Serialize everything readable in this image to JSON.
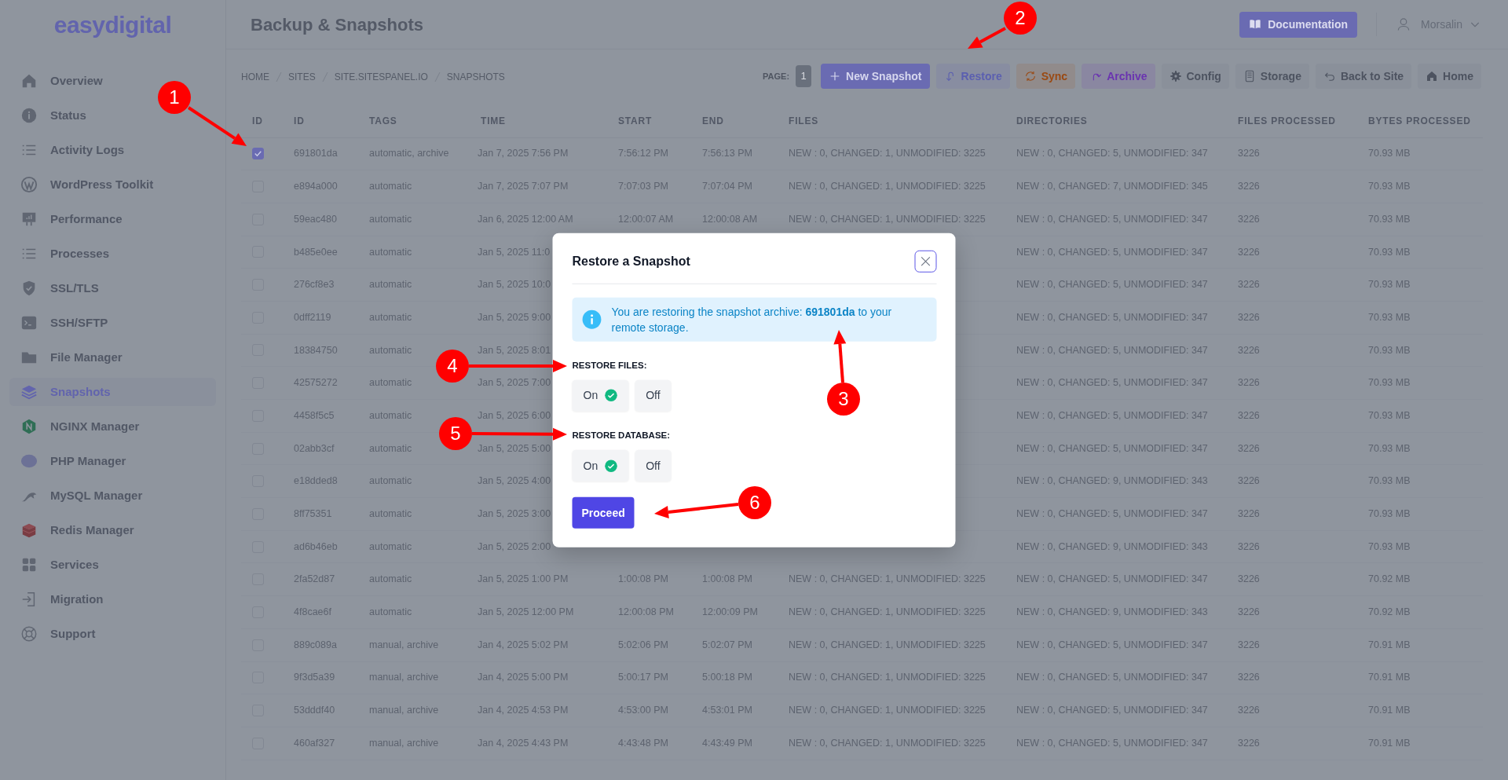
{
  "sidebar": {
    "logo": "easydigital",
    "items": [
      {
        "label": "Overview",
        "selected": false
      },
      {
        "label": "Status",
        "selected": false
      },
      {
        "label": "Activity Logs",
        "selected": false
      },
      {
        "label": "WordPress Toolkit",
        "selected": false
      },
      {
        "label": "Performance",
        "selected": false
      },
      {
        "label": "Processes",
        "selected": false
      },
      {
        "label": "SSL/TLS",
        "selected": false
      },
      {
        "label": "SSH/SFTP",
        "selected": false
      },
      {
        "label": "File Manager",
        "selected": false
      },
      {
        "label": "Snapshots",
        "selected": true
      },
      {
        "label": "NGINX Manager",
        "selected": false
      },
      {
        "label": "PHP Manager",
        "selected": false
      },
      {
        "label": "MySQL Manager",
        "selected": false
      },
      {
        "label": "Redis Manager",
        "selected": false
      },
      {
        "label": "Services",
        "selected": false
      },
      {
        "label": "Migration",
        "selected": false
      },
      {
        "label": "Support",
        "selected": false
      }
    ]
  },
  "header": {
    "title": "Backup & Snapshots",
    "documentation": "Documentation",
    "user": "Morsalin"
  },
  "breadcrumb": [
    "HOME",
    "SITES",
    "SITE.SITESPANEL.IO",
    "SNAPSHOTS"
  ],
  "toolbar": {
    "page_label": "PAGE:",
    "page": "1",
    "buttons": [
      {
        "label": "New Snapshot",
        "kind": "filled",
        "color": "#6a6bb2"
      },
      {
        "label": "Restore",
        "kind": "soft",
        "color": "#5b5fb0"
      },
      {
        "label": "Sync",
        "kind": "soft",
        "color": "#9a4a14"
      },
      {
        "label": "Archive",
        "kind": "soft",
        "color": "#6a34b0"
      },
      {
        "label": "Config",
        "kind": "plain",
        "color": "#4d5360"
      },
      {
        "label": "Storage",
        "kind": "plain",
        "color": "#4d5360"
      },
      {
        "label": "Back to Site",
        "kind": "plain",
        "color": "#4d5360"
      },
      {
        "label": "Home",
        "kind": "plain",
        "color": "#4d5360"
      }
    ]
  },
  "table": {
    "columns": [
      "ID",
      "ID",
      "TAGS",
      "TIME",
      "START",
      "END",
      "FILES",
      "DIRECTORIES",
      "FILES PROCESSED",
      "BYTES PROCESSED"
    ],
    "rows": [
      {
        "checked": true,
        "cells": [
          "",
          "691801da",
          "automatic, archive",
          "Jan 7, 2025 7:56 PM",
          "7:56:12 PM",
          "7:56:13 PM",
          "NEW : 0, CHANGED: 1, UNMODIFIED: 3225",
          "NEW : 0, CHANGED: 5, UNMODIFIED: 347",
          "3226",
          "70.93 MB"
        ]
      },
      {
        "checked": false,
        "cells": [
          "",
          "e894a000",
          "automatic",
          "Jan 7, 2025 7:07 PM",
          "7:07:03 PM",
          "7:07:04 PM",
          "NEW : 0, CHANGED: 1, UNMODIFIED: 3225",
          "NEW : 0, CHANGED: 7, UNMODIFIED: 345",
          "3226",
          "70.93 MB"
        ]
      },
      {
        "checked": false,
        "cells": [
          "",
          "59eac480",
          "automatic",
          "Jan 6, 2025 12:00 AM",
          "12:00:07 AM",
          "12:00:08 AM",
          "NEW : 0, CHANGED: 1, UNMODIFIED: 3225",
          "NEW : 0, CHANGED: 5, UNMODIFIED: 347",
          "3226",
          "70.93 MB"
        ]
      },
      {
        "checked": false,
        "cells": [
          "",
          "b485e0ee",
          "automatic",
          "Jan 5, 2025 11:0",
          null,
          null,
          null,
          "NEW : 0, CHANGED: 5, UNMODIFIED: 347",
          "3226",
          "70.93 MB"
        ]
      },
      {
        "checked": false,
        "cells": [
          "",
          "276cf8e3",
          "automatic",
          "Jan 5, 2025 10:0",
          null,
          null,
          null,
          "NEW : 0, CHANGED: 5, UNMODIFIED: 347",
          "3226",
          "70.93 MB"
        ]
      },
      {
        "checked": false,
        "cells": [
          "",
          "0dff2119",
          "automatic",
          "Jan 5, 2025 9:00",
          null,
          null,
          null,
          "NEW : 0, CHANGED: 5, UNMODIFIED: 347",
          "3226",
          "70.93 MB"
        ]
      },
      {
        "checked": false,
        "cells": [
          "",
          "18384750",
          "automatic",
          "Jan 5, 2025 8:01",
          null,
          null,
          null,
          "NEW : 0, CHANGED: 5, UNMODIFIED: 347",
          "3226",
          "70.93 MB"
        ]
      },
      {
        "checked": false,
        "cells": [
          "",
          "42575272",
          "automatic",
          "Jan 5, 2025 7:00",
          null,
          null,
          null,
          "NEW : 0, CHANGED: 5, UNMODIFIED: 347",
          "3226",
          "70.93 MB"
        ]
      },
      {
        "checked": false,
        "cells": [
          "",
          "4458f5c5",
          "automatic",
          "Jan 5, 2025 6:00",
          null,
          null,
          null,
          "NEW : 0, CHANGED: 5, UNMODIFIED: 347",
          "3226",
          "70.93 MB"
        ]
      },
      {
        "checked": false,
        "cells": [
          "",
          "02abb3cf",
          "automatic",
          "Jan 5, 2025 5:00",
          null,
          null,
          null,
          "NEW : 0, CHANGED: 5, UNMODIFIED: 347",
          "3226",
          "70.93 MB"
        ]
      },
      {
        "checked": false,
        "cells": [
          "",
          "e18dded8",
          "automatic",
          "Jan 5, 2025 4:00",
          null,
          null,
          null,
          "NEW : 0, CHANGED: 9, UNMODIFIED: 343",
          "3226",
          "70.93 MB"
        ]
      },
      {
        "checked": false,
        "cells": [
          "",
          "8ff75351",
          "automatic",
          "Jan 5, 2025 3:00",
          null,
          null,
          null,
          "NEW : 0, CHANGED: 5, UNMODIFIED: 347",
          "3226",
          "70.93 MB"
        ]
      },
      {
        "checked": false,
        "cells": [
          "",
          "ad6b46eb",
          "automatic",
          "Jan 5, 2025 2:00",
          null,
          null,
          null,
          "NEW : 0, CHANGED: 9, UNMODIFIED: 343",
          "3226",
          "70.93 MB"
        ]
      },
      {
        "checked": false,
        "cells": [
          "",
          "2fa52d87",
          "automatic",
          "Jan 5, 2025 1:00 PM",
          "1:00:08 PM",
          "1:00:08 PM",
          "NEW : 0, CHANGED: 1, UNMODIFIED: 3225",
          "NEW : 0, CHANGED: 5, UNMODIFIED: 347",
          "3226",
          "70.92 MB"
        ]
      },
      {
        "checked": false,
        "cells": [
          "",
          "4f8cae6f",
          "automatic",
          "Jan 5, 2025 12:00 PM",
          "12:00:08 PM",
          "12:00:09 PM",
          "NEW : 0, CHANGED: 1, UNMODIFIED: 3225",
          "NEW : 0, CHANGED: 9, UNMODIFIED: 343",
          "3226",
          "70.92 MB"
        ]
      },
      {
        "checked": false,
        "cells": [
          "",
          "889c089a",
          "manual, archive",
          "Jan 4, 2025 5:02 PM",
          "5:02:06 PM",
          "5:02:07 PM",
          "NEW : 0, CHANGED: 1, UNMODIFIED: 3225",
          "NEW : 0, CHANGED: 5, UNMODIFIED: 347",
          "3226",
          "70.91 MB"
        ]
      },
      {
        "checked": false,
        "cells": [
          "",
          "9f3d5a39",
          "manual, archive",
          "Jan 4, 2025 5:00 PM",
          "5:00:17 PM",
          "5:00:18 PM",
          "NEW : 0, CHANGED: 1, UNMODIFIED: 3225",
          "NEW : 0, CHANGED: 5, UNMODIFIED: 347",
          "3226",
          "70.91 MB"
        ]
      },
      {
        "checked": false,
        "cells": [
          "",
          "53dddf40",
          "manual, archive",
          "Jan 4, 2025 4:53 PM",
          "4:53:00 PM",
          "4:53:01 PM",
          "NEW : 0, CHANGED: 1, UNMODIFIED: 3225",
          "NEW : 0, CHANGED: 5, UNMODIFIED: 347",
          "3226",
          "70.91 MB"
        ]
      },
      {
        "checked": false,
        "cells": [
          "",
          "460af327",
          "manual, archive",
          "Jan 4, 2025 4:43 PM",
          "4:43:48 PM",
          "4:43:49 PM",
          "NEW : 0, CHANGED: 1, UNMODIFIED: 3225",
          "NEW : 0, CHANGED: 5, UNMODIFIED: 347",
          "3226",
          "70.91 MB"
        ]
      }
    ]
  },
  "modal": {
    "title": "Restore a Snapshot",
    "alert": "You are restoring the snapshot archive: **691801da** to your remote storage.",
    "sections": [
      {
        "label": "RESTORE FILES:",
        "options": [
          {
            "label": "On",
            "selected": true
          },
          {
            "label": "Off",
            "selected": false
          }
        ]
      },
      {
        "label": "RESTORE DATABASE:",
        "options": [
          {
            "label": "On",
            "selected": true
          },
          {
            "label": "Off",
            "selected": false
          }
        ]
      }
    ],
    "submit": "Proceed"
  },
  "annotations": [
    {
      "label": "1"
    },
    {
      "label": "2"
    },
    {
      "label": "3"
    },
    {
      "label": "4"
    },
    {
      "label": "5"
    },
    {
      "label": "6"
    }
  ]
}
